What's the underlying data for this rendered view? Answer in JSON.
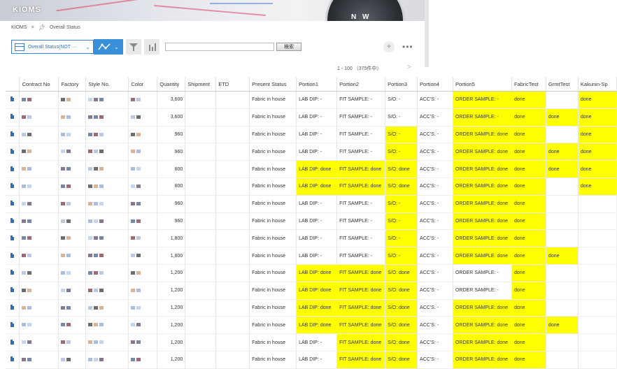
{
  "app": {
    "logo": "KIOMS"
  },
  "banner": {
    "compass_letters": [
      "N",
      "W"
    ]
  },
  "breadcrumb": {
    "root": "KIOMS",
    "sep": ">",
    "current": "Overall Status"
  },
  "toolbar": {
    "view_select": "Overall Status(NOT ···",
    "search_placeholder": "",
    "search_button": "検索",
    "plus": "+",
    "more": "•••"
  },
  "pager": {
    "range": "1 - 100 （375件中）",
    "next": ">"
  },
  "colors": {
    "highlight": "#ffff00",
    "accent": "#3a8fd9",
    "doc_icon": "#2f6db5"
  },
  "table": {
    "columns": [
      "",
      "Contract No",
      "Factory",
      "Style No.",
      "Color",
      "Quantity",
      "Shipment",
      "ETD",
      "Present Status",
      "Portion1",
      "Portion2",
      "Portion3",
      "Portion4",
      "Portion5",
      "FabricTest",
      "GrmtTest",
      "Kakunin-Sp"
    ],
    "rows": [
      {
        "qty": "3,600",
        "status": "Fabric in house",
        "p1": "LAB DIP: -",
        "p2": "FIT SAMPLE: -",
        "p3": "S/O: -",
        "p4": "ACC'S: -",
        "p5": "ORDER SAMPLE: -",
        "fab": "done",
        "grm": "",
        "kak": "done",
        "hl": [
          0,
          0,
          0,
          1,
          0,
          1
        ]
      },
      {
        "qty": "3,600",
        "status": "Fabric in house",
        "p1": "LAB DIP: -",
        "p2": "FIT SAMPLE: -",
        "p3": "S/O: -",
        "p4": "ACC'S: -",
        "p5": "ORDER SAMPLE: -",
        "fab": "done",
        "grm": "done",
        "kak": "done",
        "hl": [
          0,
          0,
          0,
          1,
          1,
          1
        ]
      },
      {
        "qty": "960",
        "status": "Fabric in house",
        "p1": "LAB DIP: -",
        "p2": "FIT SAMPLE: -",
        "p3": "S/O: -",
        "p4": "ACC'S: -",
        "p5": "ORDER SAMPLE: done",
        "fab": "done",
        "grm": "",
        "kak": "done",
        "hl": [
          0,
          0,
          1,
          1,
          0,
          1
        ]
      },
      {
        "qty": "960",
        "status": "Fabric in house",
        "p1": "LAB DIP: -",
        "p2": "FIT SAMPLE: -",
        "p3": "S/O: -",
        "p4": "ACC'S: -",
        "p5": "ORDER SAMPLE: done",
        "fab": "done",
        "grm": "done",
        "kak": "done",
        "hl": [
          0,
          0,
          1,
          1,
          1,
          1
        ]
      },
      {
        "qty": "800",
        "status": "Fabric in house",
        "p1": "LAB DIP: done",
        "p2": "FIT SAMPLE: done",
        "p3": "S/O: done",
        "p4": "ACC'S: -",
        "p5": "ORDER SAMPLE: done",
        "fab": "done",
        "grm": "done",
        "kak": "done",
        "hl": [
          1,
          1,
          1,
          1,
          1,
          1
        ]
      },
      {
        "qty": "800",
        "status": "Fabric in house",
        "p1": "LAB DIP: done",
        "p2": "FIT SAMPLE: done",
        "p3": "S/O: done",
        "p4": "ACC'S: -",
        "p5": "ORDER SAMPLE: done",
        "fab": "done",
        "grm": "",
        "kak": "done",
        "hl": [
          1,
          1,
          1,
          1,
          0,
          1
        ]
      },
      {
        "qty": "960",
        "status": "Fabric in house",
        "p1": "LAB DIP: -",
        "p2": "FIT SAMPLE: -",
        "p3": "S/O: -",
        "p4": "ACC'S: -",
        "p5": "ORDER SAMPLE: done",
        "fab": "done",
        "grm": "",
        "kak": "",
        "hl": [
          0,
          0,
          1,
          1,
          0,
          0
        ]
      },
      {
        "qty": "960",
        "status": "Fabric in house",
        "p1": "LAB DIP: -",
        "p2": "FIT SAMPLE: -",
        "p3": "S/O: -",
        "p4": "ACC'S: -",
        "p5": "ORDER SAMPLE: done",
        "fab": "done",
        "grm": "",
        "kak": "",
        "hl": [
          0,
          0,
          1,
          1,
          0,
          0
        ]
      },
      {
        "qty": "1,800",
        "status": "Fabric in house",
        "p1": "LAB DIP: -",
        "p2": "FIT SAMPLE: -",
        "p3": "S/O: -",
        "p4": "ACC'S: -",
        "p5": "ORDER SAMPLE: done",
        "fab": "done",
        "grm": "",
        "kak": "",
        "hl": [
          0,
          0,
          1,
          1,
          0,
          0
        ]
      },
      {
        "qty": "1,800",
        "status": "Fabric in house",
        "p1": "LAB DIP: -",
        "p2": "FIT SAMPLE: -",
        "p3": "S/O: -",
        "p4": "ACC'S: -",
        "p5": "ORDER SAMPLE: done",
        "fab": "done",
        "grm": "done",
        "kak": "",
        "hl": [
          0,
          0,
          1,
          1,
          1,
          0
        ]
      },
      {
        "qty": "1,200",
        "status": "Fabric in house",
        "p1": "LAB DIP: done",
        "p2": "FIT SAMPLE: done",
        "p3": "S/O: done",
        "p4": "ACC'S: -",
        "p5": "ORDER SAMPLE: -",
        "fab": "done",
        "grm": "",
        "kak": "",
        "hl": [
          1,
          1,
          1,
          0,
          0,
          0
        ]
      },
      {
        "qty": "1,200",
        "status": "Fabric in house",
        "p1": "LAB DIP: done",
        "p2": "FIT SAMPLE: done",
        "p3": "S/O: done",
        "p4": "ACC'S: -",
        "p5": "ORDER SAMPLE: -",
        "fab": "done",
        "grm": "",
        "kak": "",
        "hl": [
          1,
          1,
          1,
          0,
          0,
          0
        ]
      },
      {
        "qty": "1,200",
        "status": "Fabric in house",
        "p1": "LAB DIP: done",
        "p2": "FIT SAMPLE: done",
        "p3": "S/O: done",
        "p4": "ACC'S: -",
        "p5": "ORDER SAMPLE: done",
        "fab": "done",
        "grm": "",
        "kak": "",
        "hl": [
          1,
          1,
          1,
          1,
          0,
          0
        ]
      },
      {
        "qty": "1,200",
        "status": "Fabric in house",
        "p1": "LAB DIP: done",
        "p2": "FIT SAMPLE: done",
        "p3": "S/O: done",
        "p4": "ACC'S: -",
        "p5": "ORDER SAMPLE: done",
        "fab": "done",
        "grm": "done",
        "kak": "",
        "hl": [
          1,
          1,
          1,
          1,
          1,
          0
        ]
      },
      {
        "qty": "1,200",
        "status": "Fabric in house",
        "p1": "LAB DIP: -",
        "p2": "FIT SAMPLE: done",
        "p3": "S/O: done",
        "p4": "ACC'S: -",
        "p5": "ORDER SAMPLE: done",
        "fab": "done",
        "grm": "",
        "kak": "",
        "hl": [
          0,
          1,
          1,
          1,
          0,
          0
        ]
      },
      {
        "qty": "1,200",
        "status": "Fabric in house",
        "p1": "LAB DIP: -",
        "p2": "FIT SAMPLE: done",
        "p3": "S/O: done",
        "p4": "ACC'S: -",
        "p5": "ORDER SAMPLE: done",
        "fab": "done",
        "grm": "",
        "kak": "",
        "hl": [
          0,
          1,
          1,
          1,
          0,
          0
        ]
      }
    ]
  }
}
